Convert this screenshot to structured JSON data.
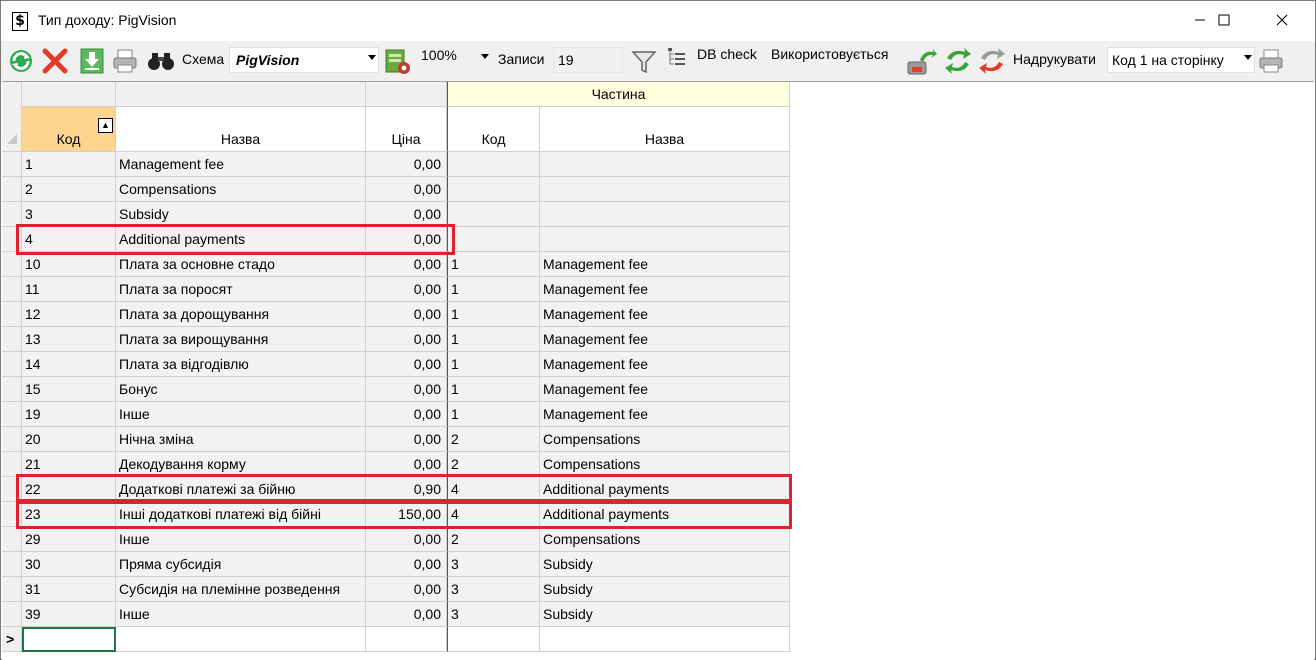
{
  "window": {
    "title": "Тип доходу: PigVision",
    "app_icon": "$",
    "controls": [
      "minimize-icon",
      "maximize-icon",
      "close-icon"
    ]
  },
  "toolbar": {
    "scheme_label": "Схема",
    "scheme_value": "PigVision",
    "zoom_value": "100%",
    "records_label": "Записи",
    "records_value": "19",
    "db_check": "DB check",
    "used": "Використовується",
    "print_label": "Надрукувати",
    "print_mode": "Код 1 на сторінку",
    "icons": [
      "refresh-icon",
      "delete-icon",
      "export-icon",
      "print-preview-icon",
      "binoculars-icon",
      "scheme-settings-icon",
      "filter-icon",
      "tree-icon",
      "share-icon",
      "transfer-icon",
      "import-icon",
      "print-icon"
    ]
  },
  "grid": {
    "group_header": "Частина",
    "columns": [
      "Код",
      "Назва",
      "Ціна",
      "Код",
      "Назва"
    ],
    "sort_indicator": "▲",
    "new_row_marker": ">",
    "rows": [
      {
        "code": "1",
        "name": "Management fee",
        "price": "0,00",
        "part_code": "",
        "part_name": ""
      },
      {
        "code": "2",
        "name": "Compensations",
        "price": "0,00",
        "part_code": "",
        "part_name": ""
      },
      {
        "code": "3",
        "name": "Subsidy",
        "price": "0,00",
        "part_code": "",
        "part_name": ""
      },
      {
        "code": "4",
        "name": "Additional payments",
        "price": "0,00",
        "part_code": "",
        "part_name": ""
      },
      {
        "code": "10",
        "name": "Плата за основне стадо",
        "price": "0,00",
        "part_code": "1",
        "part_name": "Management fee"
      },
      {
        "code": "11",
        "name": "Плата за поросят",
        "price": "0,00",
        "part_code": "1",
        "part_name": "Management fee"
      },
      {
        "code": "12",
        "name": "Плата за дорощування",
        "price": "0,00",
        "part_code": "1",
        "part_name": "Management fee"
      },
      {
        "code": "13",
        "name": "Плата за вирощування",
        "price": "0,00",
        "part_code": "1",
        "part_name": "Management fee"
      },
      {
        "code": "14",
        "name": "Плата за відгодівлю",
        "price": "0,00",
        "part_code": "1",
        "part_name": "Management fee"
      },
      {
        "code": "15",
        "name": "Бонус",
        "price": "0,00",
        "part_code": "1",
        "part_name": "Management fee"
      },
      {
        "code": "19",
        "name": "Інше",
        "price": "0,00",
        "part_code": "1",
        "part_name": "Management fee"
      },
      {
        "code": "20",
        "name": "Нічна зміна",
        "price": "0,00",
        "part_code": "2",
        "part_name": "Compensations"
      },
      {
        "code": "21",
        "name": "Декодування корму",
        "price": "0,00",
        "part_code": "2",
        "part_name": "Compensations"
      },
      {
        "code": "22",
        "name": "Додаткові платежі за бійню",
        "price": "0,90",
        "part_code": "4",
        "part_name": "Additional payments"
      },
      {
        "code": "23",
        "name": "Інші додаткові платежі від бійні",
        "price": "150,00",
        "part_code": "4",
        "part_name": "Additional payments"
      },
      {
        "code": "29",
        "name": "Інше",
        "price": "0,00",
        "part_code": "2",
        "part_name": "Compensations"
      },
      {
        "code": "30",
        "name": "Пряма субсидія",
        "price": "0,00",
        "part_code": "3",
        "part_name": "Subsidy"
      },
      {
        "code": "31",
        "name": "Субсидія на племінне розведення",
        "price": "0,00",
        "part_code": "3",
        "part_name": "Subsidy"
      },
      {
        "code": "39",
        "name": "Інше",
        "price": "0,00",
        "part_code": "3",
        "part_name": "Subsidy"
      }
    ]
  },
  "colors": {
    "highlight": "#e3202e",
    "group_header_bg": "#ffffe0",
    "sorted_header_bg": "#fdd591",
    "row_alt_bg": "#f2f2f2"
  }
}
